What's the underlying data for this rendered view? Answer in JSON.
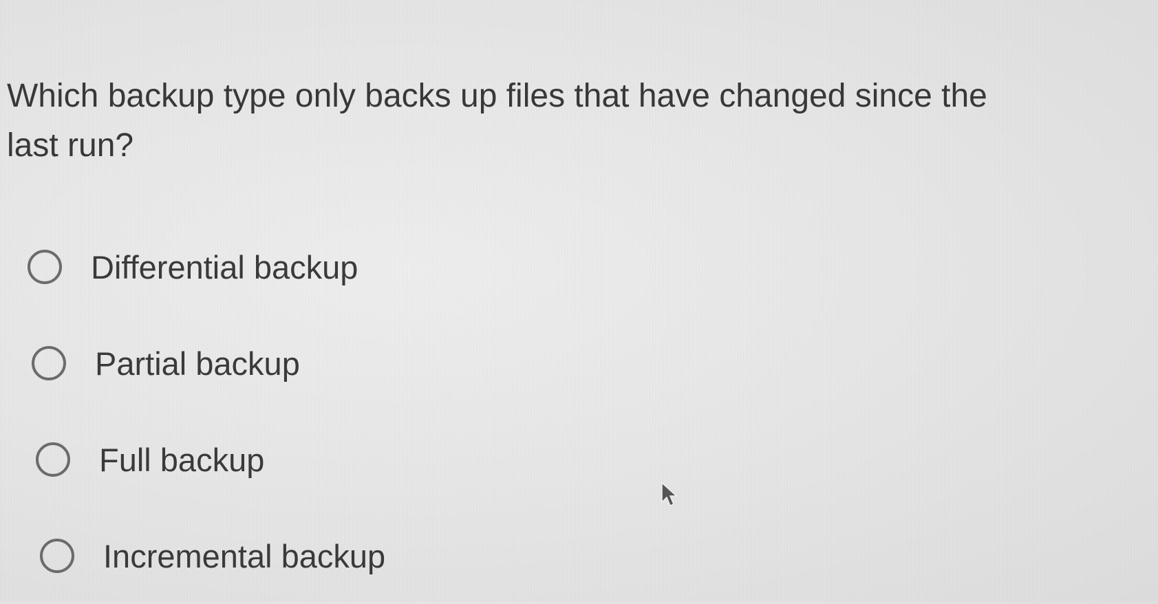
{
  "question": {
    "text": "Which backup type only backs up files that have changed since the last run?"
  },
  "options": [
    {
      "label": "Differential backup",
      "selected": false
    },
    {
      "label": "Partial backup",
      "selected": false
    },
    {
      "label": "Full backup",
      "selected": false
    },
    {
      "label": "Incremental backup",
      "selected": false
    }
  ],
  "icons": {
    "radio": "radio-unchecked-icon",
    "cursor": "mouse-pointer-icon"
  },
  "colors": {
    "background": "#e6e6e6",
    "text": "#383838",
    "radio_border": "#6b6b6b"
  }
}
